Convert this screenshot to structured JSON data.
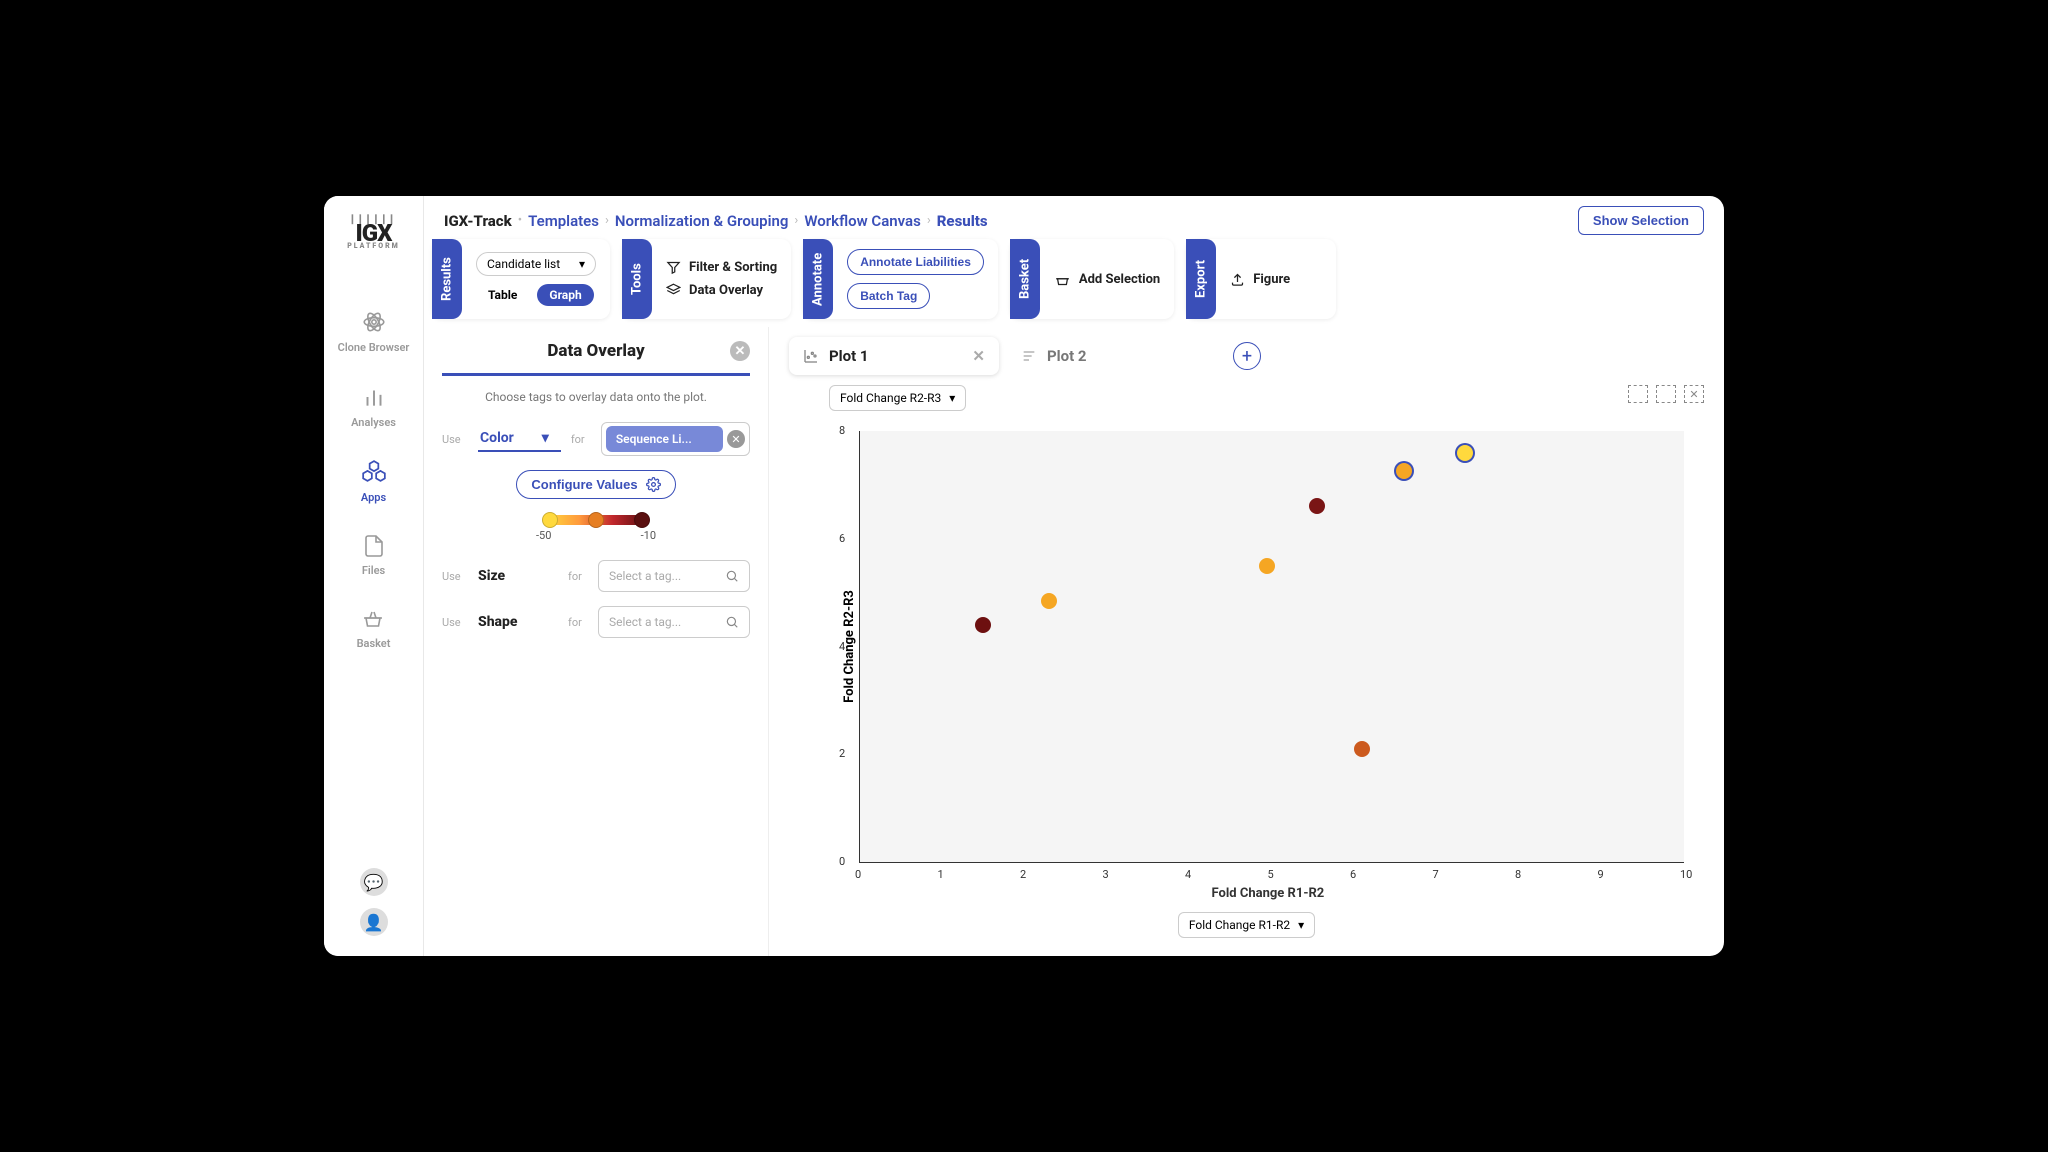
{
  "app": {
    "name": "IGX",
    "platform": "PLATFORM"
  },
  "breadcrumb": [
    "IGX-Track",
    "Templates",
    "Normalization & Grouping",
    "Workflow Canvas",
    "Results"
  ],
  "top_button": "Show Selection",
  "sidebar": {
    "items": [
      {
        "label": "Clone Browser"
      },
      {
        "label": "Analyses"
      },
      {
        "label": "Apps"
      },
      {
        "label": "Files"
      },
      {
        "label": "Basket"
      }
    ]
  },
  "ribbon": {
    "results": {
      "tab": "Results",
      "dropdown": "Candidate list",
      "view": {
        "table": "Table",
        "graph": "Graph"
      }
    },
    "tools": {
      "tab": "Tools",
      "filter": "Filter & Sorting",
      "overlay": "Data Overlay"
    },
    "annotate": {
      "tab": "Annotate",
      "liabilities": "Annotate Liabilities",
      "batch": "Batch Tag"
    },
    "basket": {
      "tab": "Basket",
      "add": "Add Selection"
    },
    "export": {
      "tab": "Export",
      "figure": "Figure"
    }
  },
  "overlay": {
    "title": "Data Overlay",
    "hint": "Choose tags to overlay data onto the plot.",
    "use": "Use",
    "for": "for",
    "rows": {
      "color": {
        "attr": "Color",
        "tag": "Sequence Li..."
      },
      "size": {
        "attr": "Size",
        "placeholder": "Select a tag..."
      },
      "shape": {
        "attr": "Shape",
        "placeholder": "Select a tag..."
      }
    },
    "configure": "Configure Values",
    "legend": {
      "min": "-50",
      "max": "-10"
    }
  },
  "plots": {
    "tabs": [
      {
        "label": "Plot 1"
      },
      {
        "label": "Plot 2"
      }
    ],
    "y_select": "Fold Change R2-R3",
    "x_select": "Fold Change R1-R2",
    "ylabel": "Fold Change R2-R3",
    "xlabel": "Fold Change R1-R2"
  },
  "chart_data": {
    "type": "scatter",
    "xlabel": "Fold Change R1-R2",
    "ylabel": "Fold Change R2-R3",
    "xlim": [
      0,
      10
    ],
    "ylim": [
      0,
      8
    ],
    "xticks": [
      0,
      1,
      2,
      3,
      4,
      5,
      6,
      7,
      8,
      9,
      10
    ],
    "yticks": [
      0,
      2,
      4,
      6,
      8
    ],
    "points": [
      {
        "x": 1.5,
        "y": 4.4,
        "color": "#6d1010"
      },
      {
        "x": 2.3,
        "y": 4.85,
        "color": "#f5a623"
      },
      {
        "x": 4.95,
        "y": 5.5,
        "color": "#f5a623"
      },
      {
        "x": 5.55,
        "y": 6.6,
        "color": "#7a1515"
      },
      {
        "x": 6.1,
        "y": 2.1,
        "color": "#cc5a1e"
      },
      {
        "x": 6.6,
        "y": 7.25,
        "color": "#f5a623",
        "selected": true
      },
      {
        "x": 7.35,
        "y": 7.6,
        "color": "#ffd93d",
        "selected": true
      }
    ]
  }
}
